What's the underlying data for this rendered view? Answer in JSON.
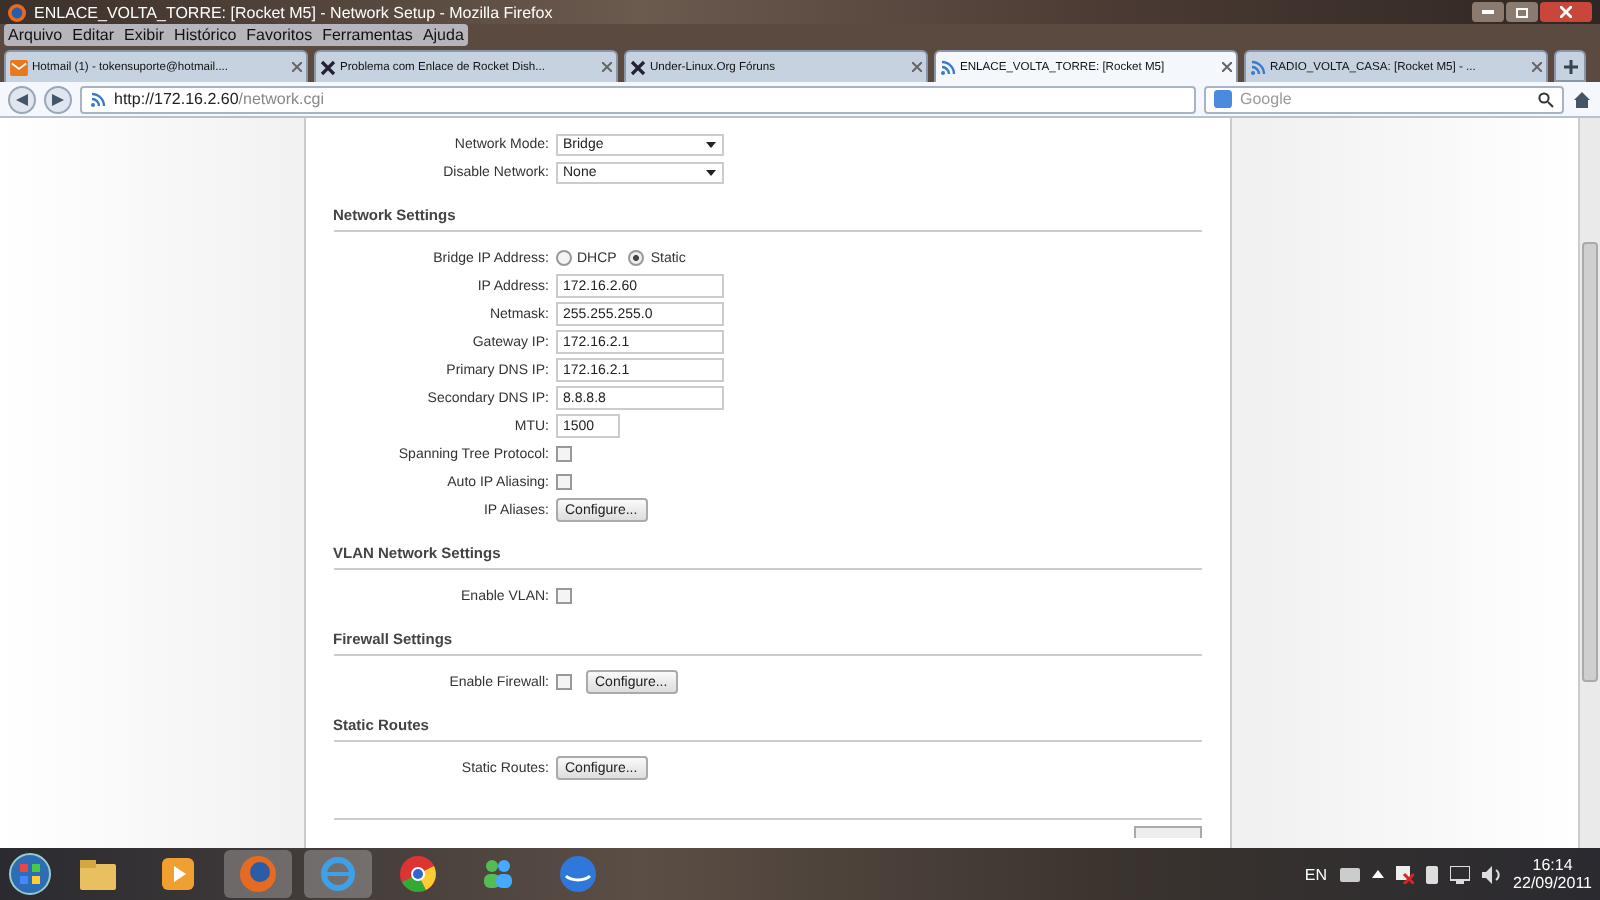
{
  "window": {
    "title": "ENLACE_VOLTA_TORRE: [Rocket M5] - Network Setup - Mozilla Firefox"
  },
  "menu": [
    "Arquivo",
    "Editar",
    "Exibir",
    "Histórico",
    "Favoritos",
    "Ferramentas",
    "Ajuda"
  ],
  "tabs": [
    {
      "label": "Hotmail (1) - tokensuporte@hotmail....",
      "kind": "mail",
      "selected": false
    },
    {
      "label": "Problema com Enlace de Rocket Dish...",
      "kind": "forum",
      "selected": false
    },
    {
      "label": "Under-Linux.Org Fóruns",
      "kind": "forum",
      "selected": false
    },
    {
      "label": "ENLACE_VOLTA_TORRE: [Rocket M5]",
      "kind": "device",
      "selected": true
    },
    {
      "label": "RADIO_VOLTA_CASA: [Rocket M5] - ...",
      "kind": "device",
      "selected": false
    }
  ],
  "address_bar": {
    "host": "http://172.16.2.60",
    "path": "/network.cgi"
  },
  "search": {
    "placeholder": "Google"
  },
  "form": {
    "top_rows": [
      {
        "kind": "select",
        "label": "Network Mode:",
        "value": "Bridge"
      },
      {
        "kind": "select",
        "label": "Disable Network:",
        "value": "None"
      }
    ],
    "sections": [
      {
        "title": "Network Settings",
        "rows": [
          {
            "kind": "radio",
            "label": "Bridge IP Address:",
            "options": [
              {
                "label": "DHCP",
                "selected": false
              },
              {
                "label": "Static",
                "selected": true
              }
            ]
          },
          {
            "kind": "text",
            "label": "IP Address:",
            "value": "172.16.2.60"
          },
          {
            "kind": "text",
            "label": "Netmask:",
            "value": "255.255.255.0"
          },
          {
            "kind": "text",
            "label": "Gateway IP:",
            "value": "172.16.2.1"
          },
          {
            "kind": "text",
            "label": "Primary DNS IP:",
            "value": "172.16.2.1"
          },
          {
            "kind": "text",
            "label": "Secondary DNS IP:",
            "value": "8.8.8.8"
          },
          {
            "kind": "number",
            "label": "MTU:",
            "value": "1500"
          },
          {
            "kind": "checkbox",
            "label": "Spanning Tree Protocol:",
            "checked": false
          },
          {
            "kind": "checkbox",
            "label": "Auto IP Aliasing:",
            "checked": false
          },
          {
            "kind": "button",
            "label": "IP Aliases:",
            "button": "Configure..."
          }
        ]
      },
      {
        "title": "VLAN Network Settings",
        "rows": [
          {
            "kind": "checkbox",
            "label": "Enable VLAN:",
            "checked": false
          }
        ]
      },
      {
        "title": "Firewall Settings",
        "rows": [
          {
            "kind": "checkbox",
            "label": "Enable Firewall:",
            "checked": false,
            "button": "Configure..."
          }
        ]
      },
      {
        "title": "Static Routes",
        "rows": [
          {
            "kind": "button",
            "label": "Static Routes:",
            "button": "Configure..."
          }
        ]
      }
    ]
  },
  "taskbar": {
    "language": "EN",
    "time": "16:14",
    "date": "22/09/2011"
  }
}
